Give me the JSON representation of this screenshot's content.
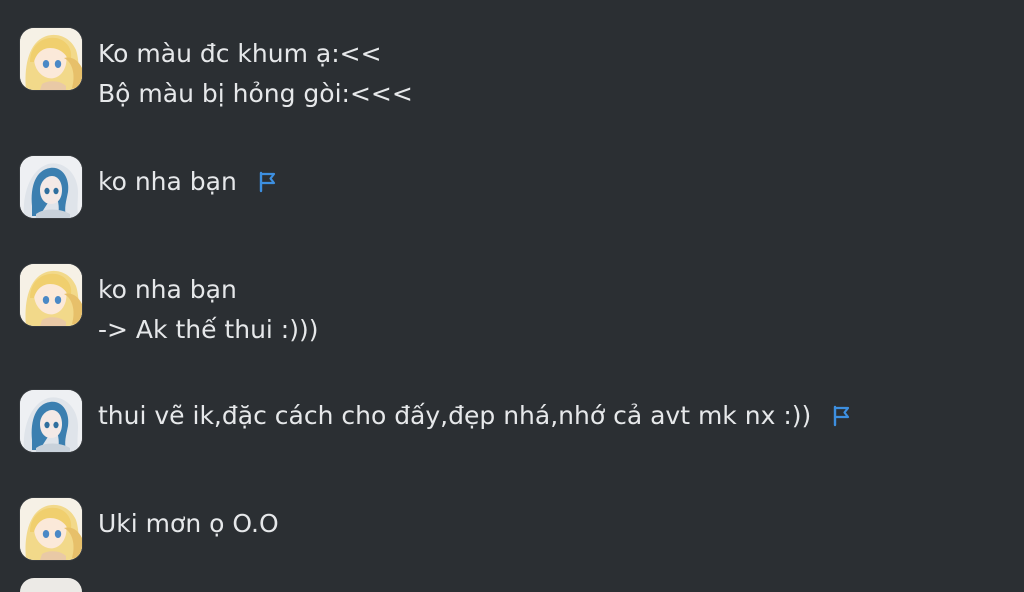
{
  "messages": [
    {
      "avatar": "blonde-anime-avatar",
      "lines": [
        "Ko màu đc khum ạ:<<",
        "Bộ màu bị hỏng gòi:<<<"
      ],
      "flag": false
    },
    {
      "avatar": "blue-hair-anime-avatar",
      "lines": [
        "ko nha bạn"
      ],
      "flag": true
    },
    {
      "avatar": "blonde-anime-avatar",
      "lines": [
        "ko nha bạn",
        "-> Ak thế thui :)))"
      ],
      "flag": false
    },
    {
      "avatar": "blue-hair-anime-avatar",
      "lines": [
        "thui vẽ ik,đặc cách cho đấy,đẹp nhá,nhớ cả avt mk nx :))"
      ],
      "flag": true
    },
    {
      "avatar": "blonde-anime-avatar",
      "lines": [
        "Uki mơn ọ O.O"
      ],
      "flag": false
    }
  ],
  "colors": {
    "background": "#2b2f33",
    "text": "#e6e8ea",
    "flag": "#3d8fe0"
  },
  "icons": {
    "flag": "flag-icon"
  }
}
